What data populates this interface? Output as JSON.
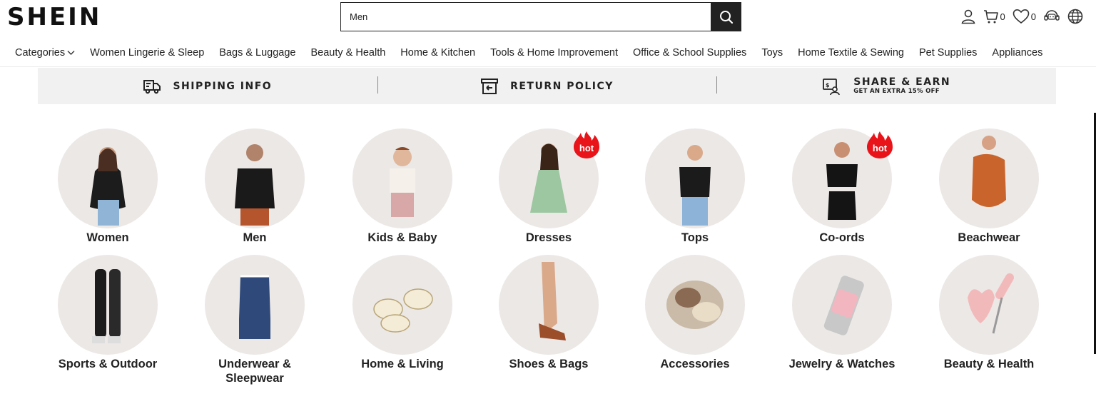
{
  "header": {
    "logo": "SHEIN",
    "search_value": "Men",
    "cart_count": "0",
    "wishlist_count": "0"
  },
  "nav": {
    "items": [
      {
        "label": "Categories"
      },
      {
        "label": "Women Lingerie & Sleep"
      },
      {
        "label": "Bags & Luggage"
      },
      {
        "label": "Beauty & Health"
      },
      {
        "label": "Home & Kitchen"
      },
      {
        "label": "Tools & Home Improvement"
      },
      {
        "label": "Office & School Supplies"
      },
      {
        "label": "Toys"
      },
      {
        "label": "Home Textile & Sewing"
      },
      {
        "label": "Pet Supplies"
      },
      {
        "label": "Appliances"
      }
    ]
  },
  "info_strip": {
    "shipping": "SHIPPING INFO",
    "returns": "RETURN POLICY",
    "share": "SHARE & EARN",
    "share_sub": "GET AN EXTRA 15% OFF"
  },
  "categories": [
    {
      "label": "Women",
      "hot": false
    },
    {
      "label": "Men",
      "hot": false
    },
    {
      "label": "Kids & Baby",
      "hot": false
    },
    {
      "label": "Dresses",
      "hot": true
    },
    {
      "label": "Tops",
      "hot": false
    },
    {
      "label": "Co-ords",
      "hot": true
    },
    {
      "label": "Beachwear",
      "hot": false
    },
    {
      "label": "Sports & Outdoor",
      "hot": false
    },
    {
      "label": "Underwear & Sleepwear",
      "hot": false
    },
    {
      "label": "Home & Living",
      "hot": false
    },
    {
      "label": "Shoes & Bags",
      "hot": false
    },
    {
      "label": "Accessories",
      "hot": false
    },
    {
      "label": "Jewelry & Watches",
      "hot": false
    },
    {
      "label": "Beauty & Health",
      "hot": false
    }
  ],
  "hot_badge": "hot",
  "colors": {
    "accent": "#222222",
    "hot": "#e8141a",
    "circle_bg": "#ece8e6",
    "strip_bg": "#f1f1f1"
  }
}
